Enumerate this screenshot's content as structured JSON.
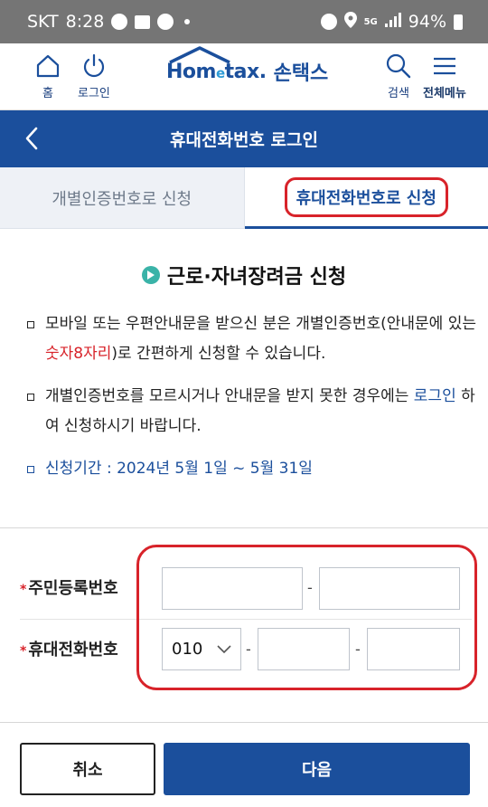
{
  "statusbar": {
    "carrier": "SKT",
    "time": "8:28",
    "network": "5G",
    "battery": "94%"
  },
  "header": {
    "home_label": "홈",
    "login_label": "로그인",
    "logo_en_1": "Hom",
    "logo_en_2": "e",
    "logo_en_3": "tax.",
    "logo_ko": "손택스",
    "search_label": "검색",
    "menu_label": "전체메뉴"
  },
  "titlebar": {
    "title": "휴대전화번호 로그인"
  },
  "tabs": [
    {
      "label": "개별인증번호로 신청",
      "active": false
    },
    {
      "label": "휴대전화번호로 신청",
      "active": true
    }
  ],
  "section": {
    "title": "근로·자녀장려금 신청"
  },
  "bullets": {
    "b1_pre": "모바일 또는 우편안내문을 받으신 분은 개별인증번호(안내문에 있는 ",
    "b1_red": "숫자8자리",
    "b1_post": ")로 간편하게 신청할 수 있습니다.",
    "b2_pre": "개별인증번호를 모르시거나 안내문을 받지 못한 경우에는 ",
    "b2_link": "로그인",
    "b2_post": " 하여 신청하시기 바랍니다.",
    "b3": "신청기간 : 2024년 5월 1일 ~ 5월 31일"
  },
  "form": {
    "rrn_label": "주민등록번호",
    "phone_label": "휴대전화번호",
    "phone_prefix": "010",
    "dash": "-"
  },
  "buttons": {
    "cancel": "취소",
    "next": "다음"
  },
  "colors": {
    "brand_blue": "#1b4f9c",
    "highlight_red": "#d8232a",
    "teal": "#3ab3a8"
  }
}
